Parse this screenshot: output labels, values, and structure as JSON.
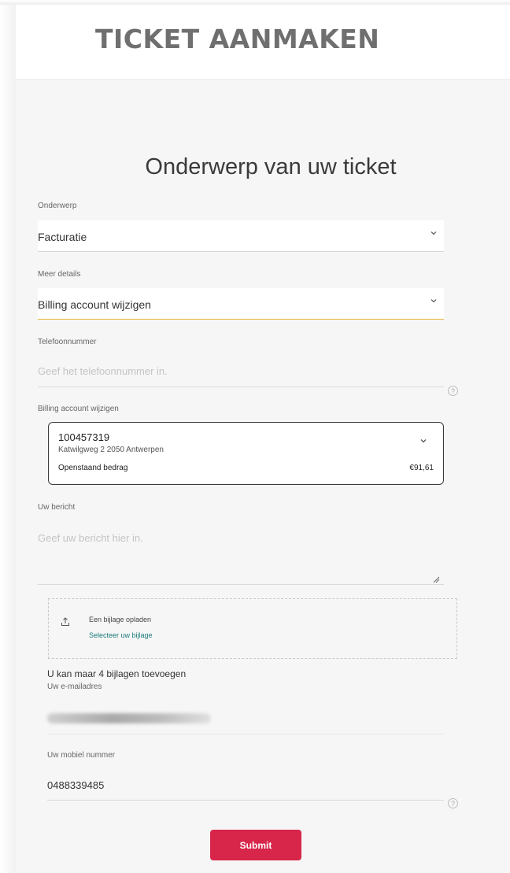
{
  "header": {
    "title": "TICKET AANMAKEN"
  },
  "section_title": "Onderwerp van uw ticket",
  "onderwerp": {
    "label": "Onderwerp",
    "value": "Facturatie"
  },
  "meer_details": {
    "label": "Meer details",
    "value": "Billing account wijzigen"
  },
  "telefoon": {
    "label": "Telefoonnummer",
    "placeholder": "Geef het telefoonnummer in."
  },
  "billing_account": {
    "label": "Billing account wijzigen",
    "number": "100457319",
    "address": "Katwilgweg 2 2050 Antwerpen",
    "amount_label": "Openstaand bedrag",
    "amount": "€91,61"
  },
  "bericht": {
    "label": "Uw bericht",
    "placeholder": "Geef uw bericht hier in."
  },
  "upload": {
    "title": "Een bijlage opladen",
    "link": "Selecteer uw bijlage"
  },
  "limit_text": "U kan maar 4 bijlagen toevoegen",
  "email": {
    "label": "Uw e-mailadres"
  },
  "mobile": {
    "label": "Uw mobiel nummer",
    "value": "0488339485"
  },
  "submit_label": "Submit",
  "colors": {
    "accent_active": "#e7b53b",
    "button": "#d7264a",
    "link": "#1a7a7a"
  }
}
